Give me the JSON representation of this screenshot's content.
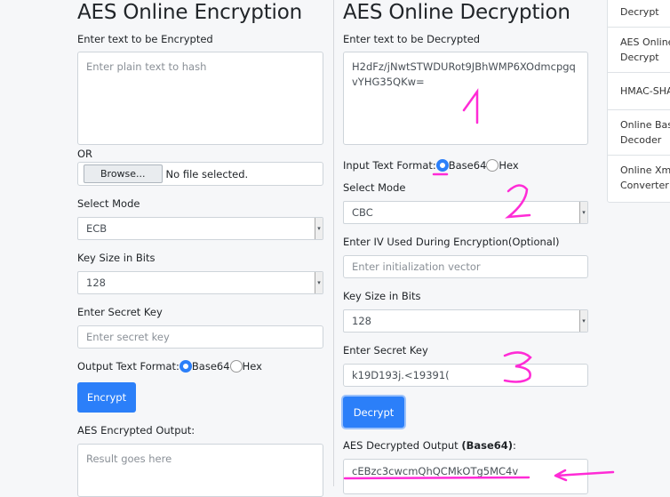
{
  "encrypt": {
    "title": "AES Online Encryption",
    "input_label": "Enter text to be Encrypted",
    "input_placeholder": "Enter plain text to hash",
    "or": "OR",
    "browse": "Browse...",
    "file_status": "No file selected.",
    "mode_label": "Select Mode",
    "mode": "ECB",
    "key_size_label": "Key Size in Bits",
    "key_size": "128",
    "key_label": "Enter Secret Key",
    "key_placeholder": "Enter secret key",
    "format_label": "Output Text Format:",
    "format_options": [
      "Base64",
      "Hex"
    ],
    "format_selected": "Base64",
    "button": "Encrypt",
    "output_label": "AES Encrypted Output:",
    "output_placeholder": "Result goes here"
  },
  "decrypt": {
    "title": "AES Online Decryption",
    "input_label": "Enter text to be Decrypted",
    "input_value": "H2dFz/jNwtSTWDURot9JBhWMP6XOdmcpgqvYHG35QKw=",
    "format_label": "Input Text Format:",
    "format_options": [
      "Base64",
      "Hex"
    ],
    "format_selected": "Base64",
    "mode_label": "Select Mode",
    "mode": "CBC",
    "iv_label": "Enter IV Used During Encryption(Optional)",
    "iv_placeholder": "Enter initialization vector",
    "key_size_label": "Key Size in Bits",
    "key_size": "128",
    "key_label": "Enter Secret Key",
    "key_value": "k19D193j.<19391(",
    "button": "Decrypt",
    "output_label": "AES Decrypted Output",
    "output_format": "(Base64)",
    "output_colon": ":",
    "output_value": "cEBzc3cwcmQhQCMkOTg5MC4v"
  },
  "sidebar": {
    "items": [
      "Decrypt",
      "AES Online\nDecrypt",
      "HMAC-SHA",
      "Online Base\nDecoder",
      "Online Xml\nConverter"
    ]
  },
  "annotations": {
    "labels": [
      "1",
      "2",
      "3"
    ],
    "color": "#ff2bd6"
  }
}
